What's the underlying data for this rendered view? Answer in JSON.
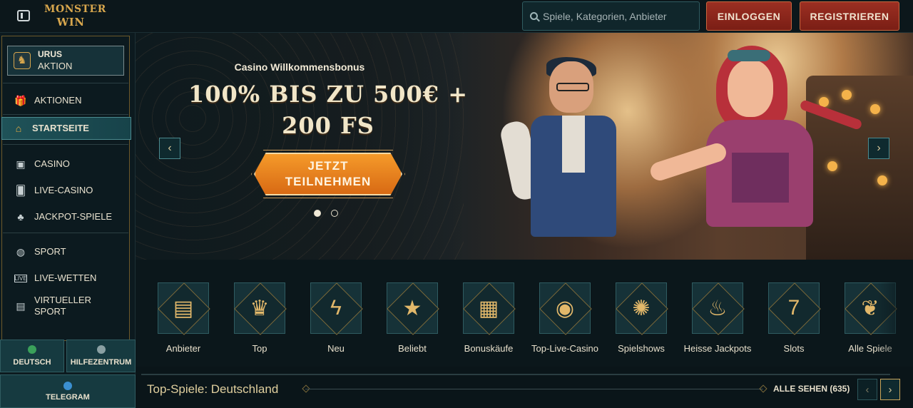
{
  "header": {
    "logo_line1": "MONSTER",
    "logo_line2": "WIN",
    "search_placeholder": "Spiele, Kategorien, Anbieter",
    "login_label": "EINLOGGEN",
    "register_label": "REGISTRIEREN"
  },
  "sidebar": {
    "promo": {
      "title": "URUS",
      "subtitle": "AKTION"
    },
    "items": [
      {
        "label": "AKTIONEN",
        "icon": "gift-icon"
      },
      {
        "label": "STARTSEITE",
        "icon": "home-icon",
        "active": true
      },
      {
        "label": "CASINO",
        "icon": "slot-machine-icon"
      },
      {
        "label": "LIVE-CASINO",
        "icon": "cards-icon"
      },
      {
        "label": "JACKPOT-SPIELE",
        "icon": "clover-icon"
      },
      {
        "label": "SPORT",
        "icon": "ball-icon"
      },
      {
        "label": "LIVE-WETTEN",
        "icon": "live-icon"
      },
      {
        "label": "VIRTUELLER SPORT",
        "icon": "virtual-sport-icon"
      }
    ],
    "language_label": "DEUTSCH",
    "help_label": "HILFEZENTRUM",
    "telegram_label": "TELEGRAM"
  },
  "hero": {
    "subtitle": "Casino Willkommensbonus",
    "title_line1": "100% BIS ZU 500€ +",
    "title_line2": "200 FS",
    "cta_line1": "JETZT",
    "cta_line2": "TEILNEHMEN",
    "slide_count": 2,
    "active_slide": 1
  },
  "categories": [
    {
      "label": "Anbieter",
      "icon": "book-icon"
    },
    {
      "label": "Top",
      "icon": "crown-icon"
    },
    {
      "label": "Neu",
      "icon": "lightning-icon"
    },
    {
      "label": "Beliebt",
      "icon": "star-icon"
    },
    {
      "label": "Bonuskäufe",
      "icon": "chest-icon"
    },
    {
      "label": "Top-Live-Casino",
      "icon": "casino-chip-icon"
    },
    {
      "label": "Spielshows",
      "icon": "wheel-icon"
    },
    {
      "label": "Heisse Jackpots",
      "icon": "flame-icon"
    },
    {
      "label": "Slots",
      "icon": "slot-machine-icon"
    },
    {
      "label": "Alle Spiele",
      "icon": "cherries-icon"
    }
  ],
  "top_games": {
    "title": "Top-Spiele: Deutschland",
    "see_all_label": "ALLE SEHEN (635)"
  },
  "colors": {
    "accent_gold": "#d7a64d",
    "button_red": "#8b2619",
    "teal_panel": "#163a40",
    "cta_orange": "#e8821f"
  }
}
